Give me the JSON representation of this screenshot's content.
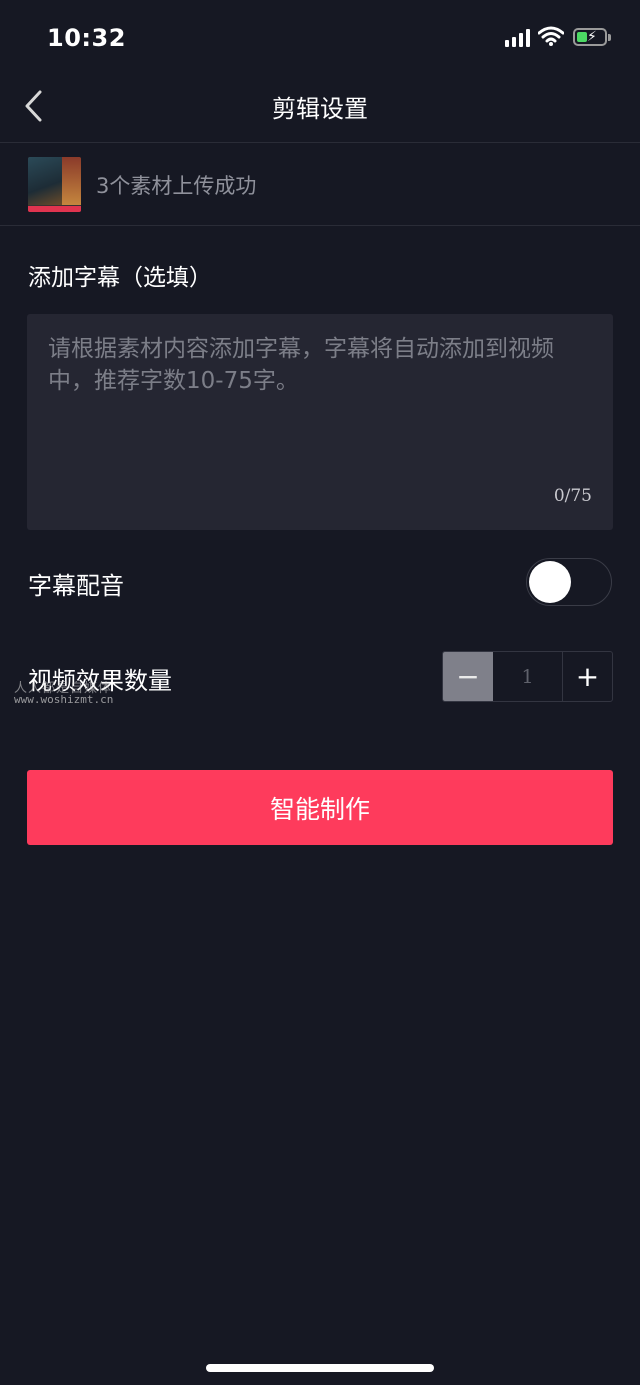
{
  "status_bar": {
    "time": "10:32",
    "icons": [
      "signal-icon",
      "wifi-icon",
      "battery-charging-icon"
    ]
  },
  "nav": {
    "title": "剪辑设置",
    "back_icon": "chevron-left-icon"
  },
  "upload": {
    "status_text": "3个素材上传成功"
  },
  "subtitle_section": {
    "label": "添加字幕（选填）",
    "placeholder": "请根据素材内容添加字幕，字幕将自动添加到视频中，推荐字数10-75字。",
    "counter": "0/75",
    "value": ""
  },
  "voiceover": {
    "label": "字幕配音",
    "enabled": false
  },
  "quantity": {
    "label": "视频效果数量",
    "value": "1",
    "minus_label": "−",
    "plus_label": "+"
  },
  "watermark": {
    "line1": "人人都是自媒体",
    "line2": "www.woshizmt.cn"
  },
  "primary_button": {
    "label": "智能制作"
  },
  "colors": {
    "background": "#161823",
    "accent": "#fe3b5c",
    "input_bg": "#252632"
  }
}
